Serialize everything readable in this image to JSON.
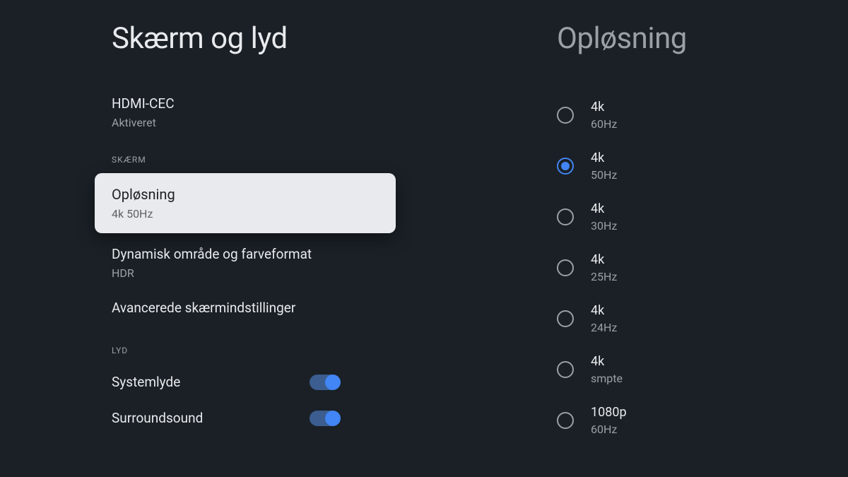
{
  "left": {
    "title": "Skærm og lyd",
    "items": [
      {
        "title": "HDMI-CEC",
        "subtitle": "Aktiveret"
      }
    ],
    "section1": "SKÆRM",
    "screen_items": [
      {
        "title": "Opløsning",
        "subtitle": "4k 50Hz",
        "selected": true
      },
      {
        "title": "Dynamisk område og farveformat",
        "subtitle": "HDR"
      },
      {
        "title": "Avancerede skærmindstillinger",
        "subtitle": ""
      }
    ],
    "section2": "LYD",
    "sound_items": [
      {
        "title": "Systemlyde",
        "toggle": true
      },
      {
        "title": "Surroundsound",
        "toggle": true
      }
    ]
  },
  "right": {
    "title": "Opløsning",
    "options": [
      {
        "title": "4k",
        "subtitle": "60Hz",
        "selected": false
      },
      {
        "title": "4k",
        "subtitle": "50Hz",
        "selected": true
      },
      {
        "title": "4k",
        "subtitle": "30Hz",
        "selected": false
      },
      {
        "title": "4k",
        "subtitle": "25Hz",
        "selected": false
      },
      {
        "title": "4k",
        "subtitle": "24Hz",
        "selected": false
      },
      {
        "title": "4k",
        "subtitle": "smpte",
        "selected": false
      },
      {
        "title": "1080p",
        "subtitle": "60Hz",
        "selected": false
      }
    ]
  }
}
